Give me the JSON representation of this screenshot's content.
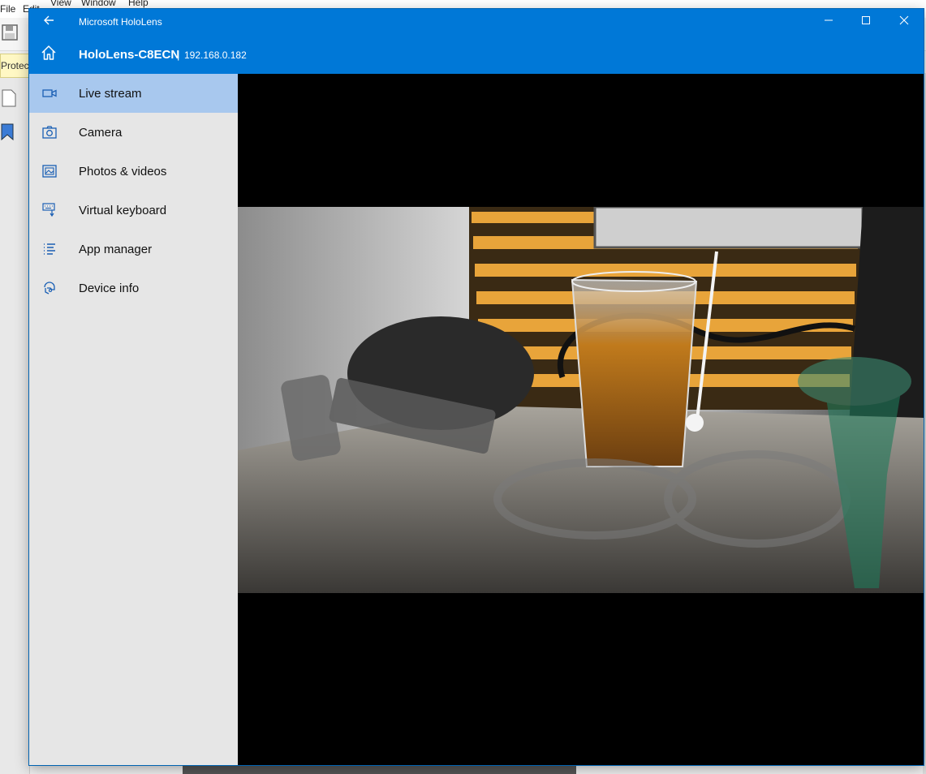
{
  "background_app": {
    "menu": [
      "File",
      "Edit",
      "View",
      "Window",
      "Help"
    ],
    "protected_label": "Protecte"
  },
  "window": {
    "title": "Microsoft HoloLens",
    "device_name": "HoloLens-C8ECN",
    "separator": "|",
    "device_ip": "192.168.0.182"
  },
  "nav": {
    "items": [
      {
        "label": "Live stream",
        "icon": "video-camera-icon",
        "active": true
      },
      {
        "label": "Camera",
        "icon": "camera-icon"
      },
      {
        "label": "Photos & videos",
        "icon": "photos-icon"
      },
      {
        "label": "Virtual keyboard",
        "icon": "keyboard-icon"
      },
      {
        "label": "App manager",
        "icon": "list-icon"
      },
      {
        "label": "Device info",
        "icon": "device-info-icon"
      }
    ]
  },
  "colors": {
    "accent": "#0078d7",
    "sidebar": "#e6e6e6",
    "active_item": "#a8c8ee",
    "stream_bg": "#000000"
  }
}
